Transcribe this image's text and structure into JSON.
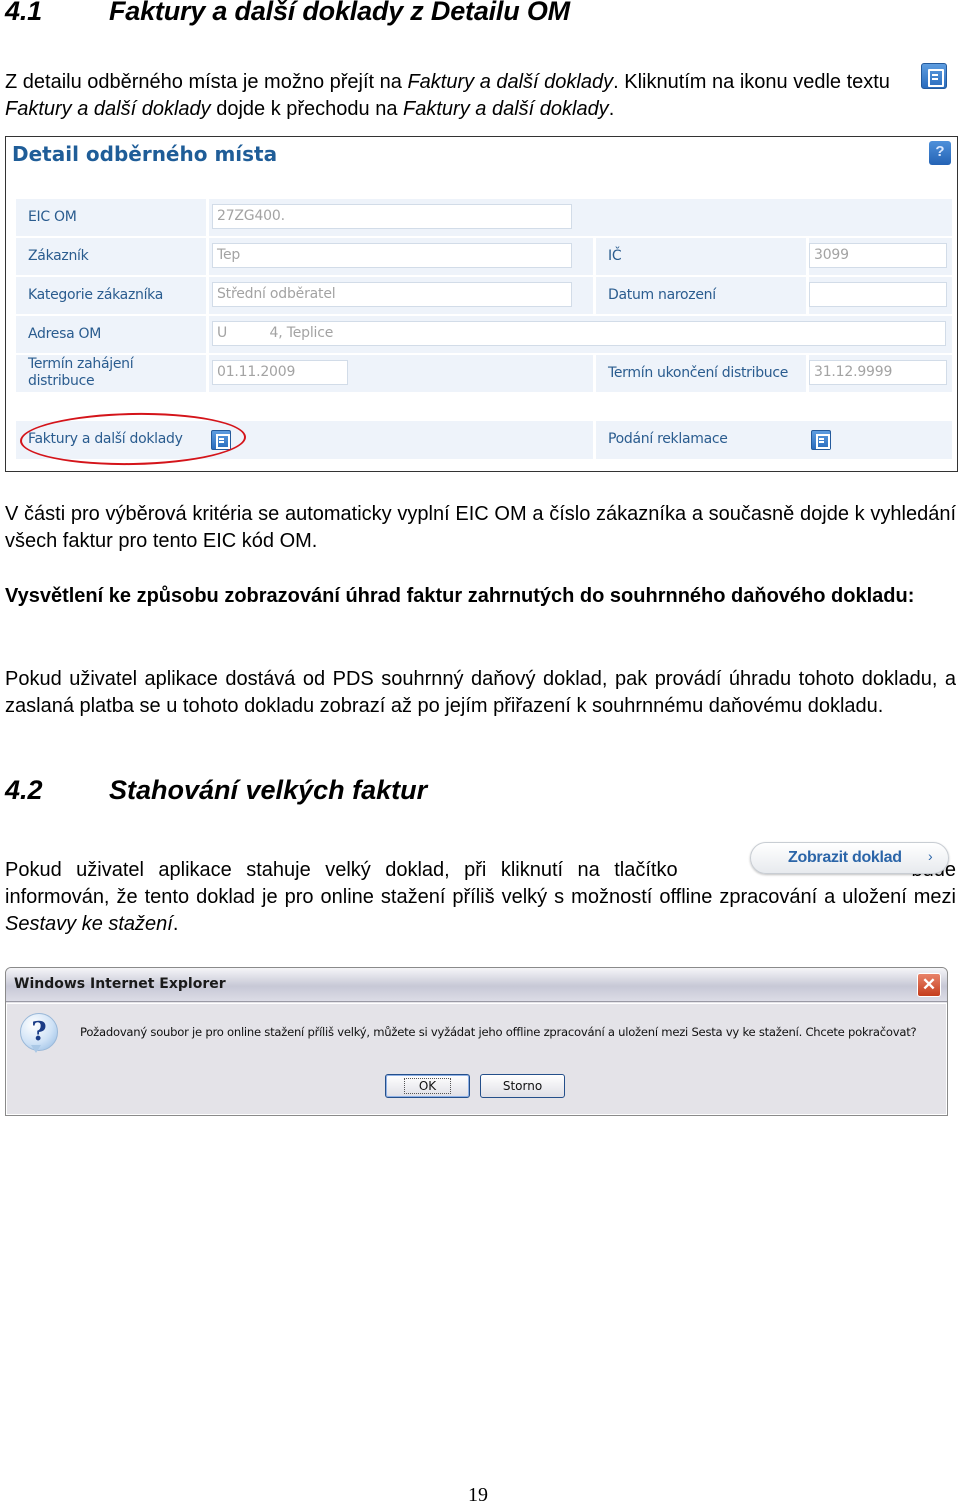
{
  "section1": {
    "number": "4.1",
    "title": "Faktury a další doklady z Detailu OM",
    "intro": {
      "before": "Z detailu odběrného místa je možno přejít na ",
      "link1": "Faktury a další doklady",
      "middle": ". Kliknutím na ikonu vedle textu ",
      "link2": "Faktury a další doklady",
      "middle2": " dojde k přechodu na ",
      "link3": "Faktury a další doklady",
      "end": "."
    },
    "intro_icon": "document-list-icon"
  },
  "detail_screenshot": {
    "title": "Detail odběrného místa",
    "help_icon": "help-icon",
    "rows": [
      {
        "label": "EIC OM",
        "value": "27ZG400."
      },
      {
        "label": "Zákazník",
        "value": "Tep",
        "label2": "IČ",
        "value2": "3099"
      },
      {
        "label": "Kategorie zákazníka",
        "value": "Střední odběratel",
        "label2": "Datum narození",
        "value2": ""
      },
      {
        "label": "Adresa OM",
        "value": "U          4, Teplice"
      },
      {
        "label": "Termín zahájení distribuce",
        "value": "01.11.2009",
        "label2": "Termín ukončení distribuce",
        "value2": "31.12.9999"
      }
    ],
    "links": [
      {
        "label": "Faktury a další doklady",
        "icon": "document-list-icon",
        "highlighted": true
      },
      {
        "label": "Podání reklamace",
        "icon": "document-list-icon",
        "highlighted": false
      }
    ],
    "highlight_color": "#d4141a"
  },
  "paragraphs": {
    "p2": "V části pro výběrová kritéria se automaticky vyplní EIC OM a číslo zákazníka a současně dojde k vyhledání všech faktur pro tento EIC kód OM.",
    "p3": "Vysvětlení ke způsobu zobrazování úhrad faktur zahrnutých do souhrnného daňového dokladu:",
    "p4": "Pokud uživatel aplikace dostává od PDS souhrnný daňový doklad, pak provádí úhradu tohoto dokladu, a zaslaná platba se u tohoto dokladu zobrazí až po jejím přiřazení k souhrnnému daňovému dokladu."
  },
  "section2": {
    "number": "4.2",
    "title": "Stahování velkých faktur",
    "p5_before": "Pokud uživatel aplikace stahuje velký doklad, při kliknutí na tlačítko ",
    "p5_after": " bude informován, že tento doklad je pro online stažení příliš velký s možností offline zpracování a uložení mezi ",
    "p5_italic": "Sestavy ke stažení",
    "p5_end": ".",
    "button_label": "Zobrazit doklad",
    "button_arrow": "›"
  },
  "dialog": {
    "title": "Windows Internet Explorer",
    "close": "✕",
    "icon": "question-icon",
    "icon_glyph": "?",
    "message": "Požadovaný soubor je pro online  stažení příliš velký, můžete si vyžádat jeho offline  zpracování a uložení mezi Sesta vy ke stažení. Chcete pokračovat?",
    "ok": "OK",
    "cancel": "Storno"
  },
  "page_number": "19"
}
